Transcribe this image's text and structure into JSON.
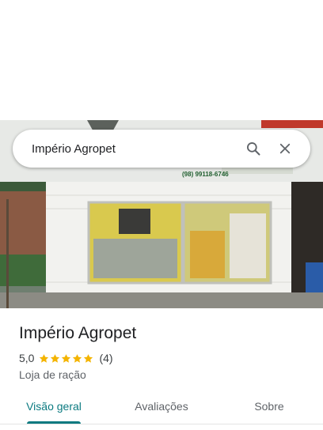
{
  "search": {
    "query": "Império Agropet"
  },
  "place": {
    "name": "Império Agropet",
    "rating": "5,0",
    "stars": 5,
    "review_count": "(4)",
    "category": "Loja de ração"
  },
  "photo": {
    "sign_phone": "(98) 99118-6746"
  },
  "tabs": [
    {
      "label": "Visão geral",
      "active": true
    },
    {
      "label": "Avaliações",
      "active": false
    },
    {
      "label": "Sobre",
      "active": false
    }
  ],
  "colors": {
    "accent": "#0b7a80",
    "star": "#f4b400"
  }
}
